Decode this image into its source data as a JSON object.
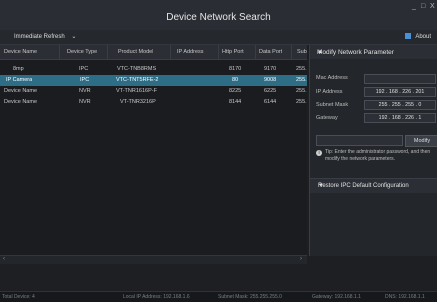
{
  "window": {
    "title": "Device Network Search",
    "min": "_",
    "restore": "□",
    "close": "X"
  },
  "toolbar": {
    "refresh": "Immediate Refresh",
    "refresh_arrow": "⌄",
    "about": "About"
  },
  "table": {
    "headers": [
      "Device Name",
      "Device Type",
      "Product Model",
      "IP Address",
      "Http Port",
      "Data Port",
      "Sub"
    ],
    "rows": [
      [
        "8mp",
        "IPC",
        "VTC-TNB8RMS",
        "",
        "8170",
        "9170",
        "255."
      ],
      [
        "IP Camera",
        "IPC",
        "VTC-TNT5RFE-2",
        "",
        "80",
        "9008",
        "255."
      ],
      [
        "Device Name",
        "NVR",
        "VT-TNR1616P-F",
        "",
        "8225",
        "6225",
        "255."
      ],
      [
        "Device Name",
        "NVR",
        "VT-TNR3216P",
        "",
        "8144",
        "6144",
        "255."
      ]
    ],
    "selected_row": 1
  },
  "panel": {
    "title": "Modify Network Parameter",
    "collapse_arrow": "▲",
    "mac_label": "Mac Address",
    "mac_value": "",
    "ip_label": "IP Address",
    "ip_value": "192 . 168 . 226 . 201",
    "mask_label": "Subnet Mask",
    "mask_value": "255 . 255 . 255 . 0",
    "gw_label": "Gateway",
    "gw_value": "192 . 168 . 226 . 1",
    "password_placeholder": "",
    "modify": "Modify",
    "tip": "Tip: Enter the administrator password, and then modify the network parameters.",
    "restore": "Restore IPC Default Configuration",
    "restore_arrow": "▼"
  },
  "status": {
    "total": "Total Device: 4",
    "local_ip": "Local IP Address: 192.168.1.6",
    "subnet": "Subnet Mask: 255.255.255.0",
    "gateway": "Gateway: 192.168.1.1",
    "dns": "DNS: 192.168.1.1"
  }
}
